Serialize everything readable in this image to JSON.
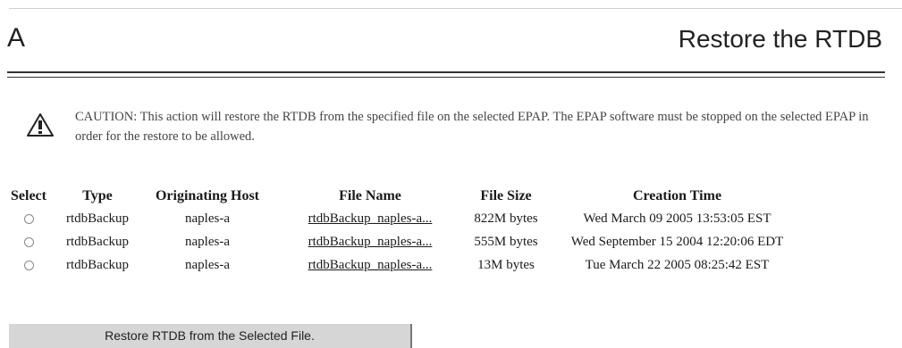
{
  "header": {
    "section_letter": "A",
    "title": "Restore the RTDB"
  },
  "caution": {
    "icon": "warning-triangle-icon",
    "text": "CAUTION: This action will restore the RTDB from the specified file on the selected EPAP. The EPAP software must be stopped on the selected EPAP in order for the restore to be allowed."
  },
  "table": {
    "columns": [
      "Select",
      "Type",
      "Originating Host",
      "File Name",
      "File Size",
      "Creation Time"
    ],
    "rows": [
      {
        "type": "rtdbBackup",
        "host": "naples-a",
        "file": "rtdbBackup_naples-a...",
        "size": "822M bytes",
        "time": "Wed March 09 2005 13:53:05 EST"
      },
      {
        "type": "rtdbBackup",
        "host": "naples-a",
        "file": "rtdbBackup_naples-a...",
        "size": "555M bytes",
        "time": "Wed September 15 2004 12:20:06 EDT"
      },
      {
        "type": "rtdbBackup",
        "host": "naples-a",
        "file": "rtdbBackup_naples-a...",
        "size": "13M bytes",
        "time": "Tue March 22 2005 08:25:42 EST"
      }
    ]
  },
  "actions": {
    "restore_label": "Restore RTDB from the Selected File."
  }
}
